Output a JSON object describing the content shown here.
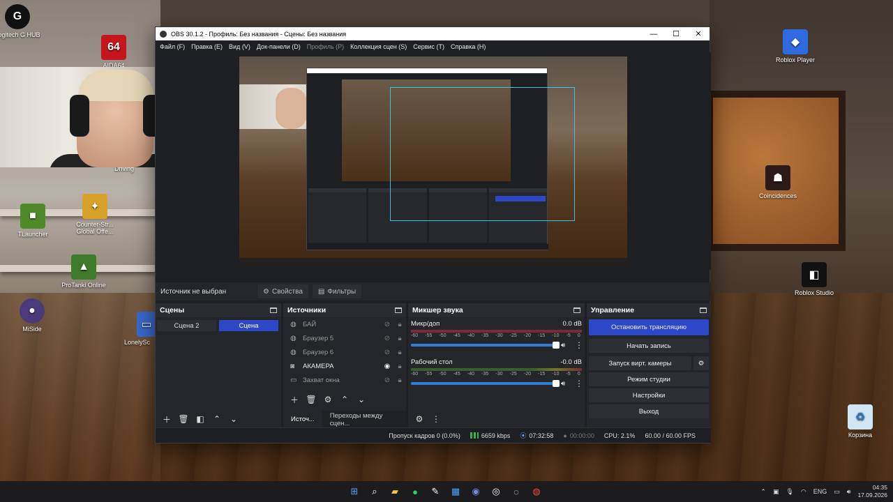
{
  "desktop": {
    "icons": [
      {
        "id": "logitech",
        "label": "Logitech G HUB"
      },
      {
        "id": "aida",
        "label": "AIDA64"
      },
      {
        "id": "driving",
        "label": "Driving"
      },
      {
        "id": "tlauncher",
        "label": "TLauncher"
      },
      {
        "id": "counter",
        "label": "Counter-Str... Global Offe..."
      },
      {
        "id": "protanki",
        "label": "ProTanki Online"
      },
      {
        "id": "miside",
        "label": "MiSide"
      },
      {
        "id": "lonely",
        "label": "LonelySc"
      },
      {
        "id": "roblox-player",
        "label": "Roblox Player"
      },
      {
        "id": "coincidences",
        "label": "Coincidences"
      },
      {
        "id": "roblox-studio",
        "label": "Roblox Studio"
      },
      {
        "id": "recycle",
        "label": "Корзина"
      }
    ]
  },
  "window": {
    "title": "OBS 30.1.2 - Профиль: Без названия - Сцены: Без названия",
    "minimize": "—",
    "maximize": "☐",
    "close": "✕"
  },
  "menu": [
    {
      "label": "Файл (F)",
      "dim": false
    },
    {
      "label": "Правка (E)",
      "dim": false
    },
    {
      "label": "Вид (V)",
      "dim": false
    },
    {
      "label": "Док-панели (D)",
      "dim": false
    },
    {
      "label": "Профиль (P)",
      "dim": true
    },
    {
      "label": "Коллекция сцен (S)",
      "dim": false
    },
    {
      "label": "Сервис (T)",
      "dim": false
    },
    {
      "label": "Справка (H)",
      "dim": false
    }
  ],
  "source_bar": {
    "no_source": "Источник не выбран",
    "properties": "Свойства",
    "filters": "Фильтры"
  },
  "scenes": {
    "title": "Сцены",
    "items": [
      "Сцена 2",
      "Сцена"
    ],
    "active_index": 1
  },
  "sources": {
    "title": "Источники",
    "items": [
      {
        "name": "БАЙ",
        "icon": "browser-icon",
        "visible": false
      },
      {
        "name": "Браузер 5",
        "icon": "browser-icon",
        "visible": false
      },
      {
        "name": "Браузер 6",
        "icon": "browser-icon",
        "visible": false
      },
      {
        "name": "АКАМЕРА",
        "icon": "camera-icon",
        "visible": true
      },
      {
        "name": "Захват окна",
        "icon": "window-icon",
        "visible": false
      }
    ],
    "tabs": [
      "Источ...",
      "Переходы между сцен..."
    ]
  },
  "mixer": {
    "title": "Микшер звука",
    "channels": [
      {
        "name": "Микр/доп",
        "db": "0.0 dB"
      },
      {
        "name": "Рабочий стол",
        "db": "-0.0 dB"
      }
    ],
    "scale": [
      "-60",
      "-55",
      "-50",
      "-45",
      "-40",
      "-35",
      "-30",
      "-25",
      "-20",
      "-15",
      "-10",
      "-5",
      "0"
    ]
  },
  "controls": {
    "title": "Управление",
    "stop_stream": "Остановить трансляцию",
    "start_record": "Начать запись",
    "virtual_cam": "Запуск вирт. камеры",
    "studio_mode": "Режим студии",
    "settings": "Настройки",
    "exit": "Выход"
  },
  "status": {
    "dropped": "Пропуск кадров 0 (0.0%)",
    "bitrate": "6659 kbps",
    "stream_time": "07:32:58",
    "record_time": "00:00:00",
    "cpu": "CPU: 2.1%",
    "fps": "60.00 / 60.00 FPS"
  },
  "taskbar": {
    "lang": "ENG",
    "time": "04:35",
    "date": "17.09.2026"
  },
  "colors": {
    "accent": "#2c48c8",
    "panel": "#25262a",
    "window_bg": "#1e1f22"
  }
}
